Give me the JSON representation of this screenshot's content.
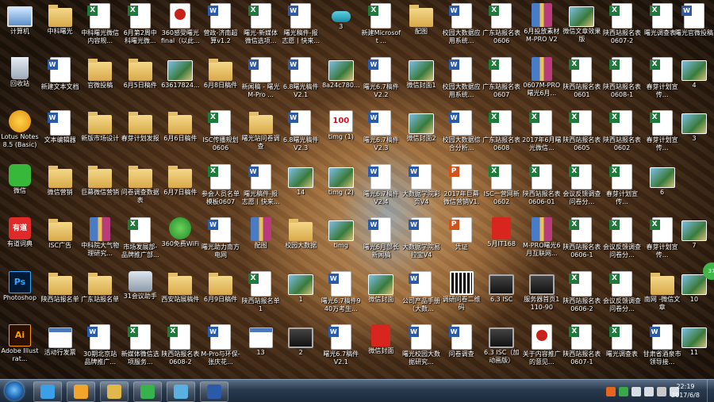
{
  "desktop": {
    "icons": [
      {
        "label": "计算机",
        "type": "pc",
        "icon": "computer-icon"
      },
      {
        "label": "中科曙光",
        "type": "folder",
        "icon": "folder-icon"
      },
      {
        "label": "中科曙光微信内容规...",
        "type": "xls",
        "icon": "excel-file-icon"
      },
      {
        "label": "6月第2周中科曙光微...",
        "type": "xls",
        "icon": "excel-file-icon"
      },
      {
        "label": "360感受曙光final（以此...",
        "type": "pdf",
        "icon": "pdf-file-icon"
      },
      {
        "label": "营政-济南超算v1.2",
        "type": "doc",
        "icon": "word-file-icon"
      },
      {
        "label": "曙光-新媒体微信选项...",
        "type": "xls",
        "icon": "excel-file-icon"
      },
      {
        "label": "曙光稿件-报志愿丨快来...",
        "type": "doc",
        "icon": "word-file-icon"
      },
      {
        "label": "3",
        "type": "lnk",
        "icon": "shortcut-icon"
      },
      {
        "label": "新建Microsoft ...",
        "type": "xls",
        "icon": "excel-file-icon"
      },
      {
        "label": "配图",
        "type": "folder",
        "icon": "folder-icon"
      },
      {
        "label": "校园大数据应用系统...",
        "type": "doc",
        "icon": "word-file-icon"
      },
      {
        "label": "广东站报名表0606",
        "type": "xls",
        "icon": "excel-file-icon"
      },
      {
        "label": "6月投放素材M-PRO V2",
        "type": "zip",
        "icon": "archive-icon"
      },
      {
        "label": "微信文章效果版",
        "type": "img",
        "icon": "image-file-icon"
      },
      {
        "label": "陕西站报名表0607-2",
        "type": "xls",
        "icon": "excel-file-icon"
      },
      {
        "label": "曙光调查表2",
        "type": "xls",
        "icon": "excel-file-icon"
      },
      {
        "label": "曙光官微投稿",
        "type": "doc",
        "icon": "word-file-icon"
      },
      {
        "label": "回收站",
        "type": "bin",
        "icon": "recycle-bin-icon"
      },
      {
        "label": "新建文本文档",
        "type": "doc",
        "icon": "text-file-icon"
      },
      {
        "label": "官微投稿",
        "type": "folder",
        "icon": "folder-icon"
      },
      {
        "label": "6月5日稿件",
        "type": "folder",
        "icon": "folder-icon"
      },
      {
        "label": "63617824...",
        "type": "img",
        "icon": "image-file-icon"
      },
      {
        "label": "6月8日稿件",
        "type": "folder",
        "icon": "folder-icon"
      },
      {
        "label": "新闻稿 - 曙光M-Pro ...",
        "type": "doc",
        "icon": "word-file-icon"
      },
      {
        "label": "6.8曙光稿件V2.1",
        "type": "doc",
        "icon": "word-file-icon"
      },
      {
        "label": "8a24c780...",
        "type": "img",
        "icon": "image-file-icon"
      },
      {
        "label": "曙光6.7稿件V2.2",
        "type": "doc",
        "icon": "word-file-icon"
      },
      {
        "label": "微信封面1",
        "type": "img",
        "icon": "image-file-icon"
      },
      {
        "label": "校园大数据应用系统...",
        "type": "doc",
        "icon": "word-file-icon"
      },
      {
        "label": "广东站报名表0607",
        "type": "xls",
        "icon": "excel-file-icon"
      },
      {
        "label": "0607M-PRO曙光6月...",
        "type": "zip",
        "icon": "archive-icon"
      },
      {
        "label": "陕西站报名表0601",
        "type": "xls",
        "icon": "excel-file-icon"
      },
      {
        "label": "陕西站报名表0608-1",
        "type": "xls",
        "icon": "excel-file-icon"
      },
      {
        "label": "春芽计划宣传...",
        "type": "xls",
        "icon": "excel-file-icon"
      },
      {
        "label": "4",
        "type": "img",
        "icon": "image-file-icon"
      },
      {
        "label": "Lotus Notes 8.5 (Basic)",
        "type": "lotus",
        "icon": "lotus-notes-icon"
      },
      {
        "label": "文本编辑器",
        "type": "doc",
        "icon": "word-file-icon"
      },
      {
        "label": "新版市场设计",
        "type": "folder",
        "icon": "folder-icon"
      },
      {
        "label": "春芽计划发报",
        "type": "folder",
        "icon": "folder-icon"
      },
      {
        "label": "6月6日稿件",
        "type": "folder",
        "icon": "folder-icon"
      },
      {
        "label": "ISC传播规划0606",
        "type": "xls",
        "icon": "excel-file-icon"
      },
      {
        "label": "曙光站问卷调查",
        "type": "folder",
        "icon": "folder-icon"
      },
      {
        "label": "6.8曙光稿件V2.3",
        "type": "doc",
        "icon": "word-file-icon"
      },
      {
        "label": "timg (1)",
        "type": "100",
        "icon": "image-file-icon"
      },
      {
        "label": "曙光6.7稿件V2.3",
        "type": "doc",
        "icon": "word-file-icon"
      },
      {
        "label": "微信封面2",
        "type": "img",
        "icon": "image-file-icon"
      },
      {
        "label": "校园大数据综合分析...",
        "type": "doc",
        "icon": "word-file-icon"
      },
      {
        "label": "广东站报名表0608",
        "type": "xls",
        "icon": "excel-file-icon"
      },
      {
        "label": "2017年6月曙光微信...",
        "type": "xls",
        "icon": "excel-file-icon"
      },
      {
        "label": "陕西站报名表0605",
        "type": "xls",
        "icon": "excel-file-icon"
      },
      {
        "label": "陕西站报名表0602",
        "type": "xls",
        "icon": "excel-file-icon"
      },
      {
        "label": "春芽计划宣传...",
        "type": "xls",
        "icon": "excel-file-icon"
      },
      {
        "label": "3",
        "type": "img",
        "icon": "image-file-icon"
      },
      {
        "label": "微信",
        "type": "wechat",
        "icon": "wechat-icon"
      },
      {
        "label": "微信营销",
        "type": "folder",
        "icon": "folder-icon"
      },
      {
        "label": "巨幕微信营销",
        "type": "folder",
        "icon": "folder-icon"
      },
      {
        "label": "问卷调查数据表",
        "type": "folder",
        "icon": "folder-icon"
      },
      {
        "label": "6月7日稿件",
        "type": "folder",
        "icon": "folder-icon"
      },
      {
        "label": "参会人员名单模板0607",
        "type": "xls",
        "icon": "excel-file-icon"
      },
      {
        "label": "曙光稿件-报志愿丨快来...",
        "type": "doc",
        "icon": "word-file-icon"
      },
      {
        "label": "14",
        "type": "img",
        "icon": "image-file-icon"
      },
      {
        "label": "timg (2)",
        "type": "img",
        "icon": "image-file-icon"
      },
      {
        "label": "曙光6.7稿件V2.4",
        "type": "doc",
        "icon": "word-file-icon"
      },
      {
        "label": "大数据学院彩页V4",
        "type": "doc",
        "icon": "word-file-icon"
      },
      {
        "label": "2017年巨幕微信营销V1.0",
        "type": "ppt",
        "icon": "powerpoint-file-icon"
      },
      {
        "label": "ISC一营网新0602",
        "type": "xls",
        "icon": "excel-file-icon"
      },
      {
        "label": "陕西站报名表0606-01",
        "type": "xls",
        "icon": "excel-file-icon"
      },
      {
        "label": "会议反馈调查问卷分...",
        "type": "xls",
        "icon": "excel-file-icon"
      },
      {
        "label": "春芽计划宣传...",
        "type": "xls",
        "icon": "excel-file-icon"
      },
      {
        "label": "6",
        "type": "img",
        "icon": "image-file-icon"
      },
      {
        "label": "有道词典",
        "type": "youdao",
        "icon": "youdao-dictionary-icon"
      },
      {
        "label": "ISC广告",
        "type": "folder",
        "icon": "folder-icon"
      },
      {
        "label": "中科院大气物理研究...",
        "type": "zip",
        "icon": "archive-icon"
      },
      {
        "label": "市场发展部-品牌推广部...",
        "type": "xls",
        "icon": "excel-file-icon"
      },
      {
        "label": "360免费WiFi",
        "type": "green",
        "icon": "wifi-app-icon"
      },
      {
        "label": "曙光助力南方电网",
        "type": "doc",
        "icon": "word-file-icon"
      },
      {
        "label": "配图",
        "type": "zip",
        "icon": "archive-icon"
      },
      {
        "label": "校园大数据",
        "type": "folder",
        "icon": "folder-icon"
      },
      {
        "label": "timg",
        "type": "img",
        "icon": "image-file-icon"
      },
      {
        "label": "曙光6月部长新闻稿",
        "type": "doc",
        "icon": "word-file-icon"
      },
      {
        "label": "大数据学院易拉宝V4",
        "type": "doc",
        "icon": "word-file-icon"
      },
      {
        "label": "凭证",
        "type": "ppt",
        "icon": "powerpoint-file-icon"
      },
      {
        "label": "5月IT168",
        "type": "red",
        "icon": "image-file-icon"
      },
      {
        "label": "M-PRO曙光6月互联网...",
        "type": "zip",
        "icon": "archive-icon"
      },
      {
        "label": "陕西站报名表0606-1",
        "type": "xls",
        "icon": "excel-file-icon"
      },
      {
        "label": "会议反馈调查问卷分...",
        "type": "xls",
        "icon": "excel-file-icon"
      },
      {
        "label": "春芽计划宣传...",
        "type": "xls",
        "icon": "excel-file-icon"
      },
      {
        "label": "7",
        "type": "img",
        "icon": "image-file-icon"
      },
      {
        "label": "Photoshop",
        "type": "ps",
        "icon": "photoshop-icon"
      },
      {
        "label": "陕西站报名单",
        "type": "folder",
        "icon": "folder-icon"
      },
      {
        "label": "广东站报名单",
        "type": "folder",
        "icon": "folder-icon"
      },
      {
        "label": "31会议助手",
        "type": "sys",
        "icon": "meeting-assistant-icon"
      },
      {
        "label": "西安站展稿件",
        "type": "folder",
        "icon": "folder-icon"
      },
      {
        "label": "6月9日稿件",
        "type": "folder",
        "icon": "folder-icon"
      },
      {
        "label": "陕西站报名单1",
        "type": "xls",
        "icon": "excel-file-icon"
      },
      {
        "label": "1",
        "type": "img",
        "icon": "image-file-icon"
      },
      {
        "label": "曙光6.7稿件940万考生...",
        "type": "doc",
        "icon": "word-file-icon"
      },
      {
        "label": "微信封面",
        "type": "img",
        "icon": "image-file-icon"
      },
      {
        "label": "公司产品手册（大数...",
        "type": "doc",
        "icon": "word-file-icon"
      },
      {
        "label": "调研问卷二维码",
        "type": "qr",
        "icon": "qr-code-icon"
      },
      {
        "label": "6.3 ISC",
        "type": "video",
        "icon": "video-file-icon"
      },
      {
        "label": "服务器首页1110-90",
        "type": "video",
        "icon": "video-file-icon"
      },
      {
        "label": "陕西站报名表0606-2",
        "type": "xls",
        "icon": "excel-file-icon"
      },
      {
        "label": "会议反馈调查问卷分...",
        "type": "xls",
        "icon": "excel-file-icon"
      },
      {
        "label": "南网 -微信文章",
        "type": "folder",
        "icon": "folder-icon"
      },
      {
        "label": "10",
        "type": "img",
        "icon": "image-file-icon"
      },
      {
        "label": "Adobe Illustrat...",
        "type": "ai",
        "icon": "illustrator-icon"
      },
      {
        "label": "活动行发票",
        "type": "web",
        "icon": "image-file-icon"
      },
      {
        "label": "30期北京站品牌推广...",
        "type": "doc",
        "icon": "word-file-icon"
      },
      {
        "label": "新媒体微信选项服务...",
        "type": "xls",
        "icon": "excel-file-icon"
      },
      {
        "label": "陕西站报名表0608-2",
        "type": "xls",
        "icon": "excel-file-icon"
      },
      {
        "label": "M-Pro与环保-张庆花...",
        "type": "doc",
        "icon": "word-file-icon"
      },
      {
        "label": "13",
        "type": "web",
        "icon": "image-file-icon"
      },
      {
        "label": "2",
        "type": "video",
        "icon": "image-file-icon"
      },
      {
        "label": "曙光6.7稿件V2.1",
        "type": "doc",
        "icon": "word-file-icon"
      },
      {
        "label": "微信封面",
        "type": "red",
        "icon": "image-file-icon"
      },
      {
        "label": "曙光校园大数据研究...",
        "type": "doc",
        "icon": "word-file-icon"
      },
      {
        "label": "问卷调查",
        "type": "doc",
        "icon": "word-file-icon"
      },
      {
        "label": "6.3 ISC（加动画版）",
        "type": "video",
        "icon": "video-file-icon"
      },
      {
        "label": "关于内容推广的意见...",
        "type": "pdf",
        "icon": "pdf-file-icon"
      },
      {
        "label": "陕西站报名表0607-1",
        "type": "xls",
        "icon": "excel-file-icon"
      },
      {
        "label": "曙光调查表",
        "type": "xls",
        "icon": "excel-file-icon"
      },
      {
        "label": "甘肃省酒泉市领导接...",
        "type": "doc",
        "icon": "word-file-icon"
      },
      {
        "label": "11",
        "type": "img",
        "icon": "image-file-icon"
      }
    ],
    "side_badge": "37"
  },
  "taskbar": {
    "start_icon": "windows-start-icon",
    "pinned": [
      {
        "icon": "ie-browser-icon",
        "color": "#3aa1e8"
      },
      {
        "icon": "lotus-notes-icon",
        "color": "#f2a52a"
      },
      {
        "icon": "file-explorer-icon",
        "color": "#e2b84a"
      },
      {
        "icon": "360-browser-icon",
        "color": "#37b24d"
      },
      {
        "icon": "photos-icon",
        "color": "#5ab0e0"
      },
      {
        "icon": "word-icon",
        "color": "#2a5aa8"
      }
    ],
    "tray_icons": [
      "orange-app-icon",
      "chat-icon",
      "network-icon",
      "volume-icon",
      "security-icon",
      "flag-icon"
    ],
    "clock_time": "22:19",
    "clock_date": "2017/6/8"
  }
}
